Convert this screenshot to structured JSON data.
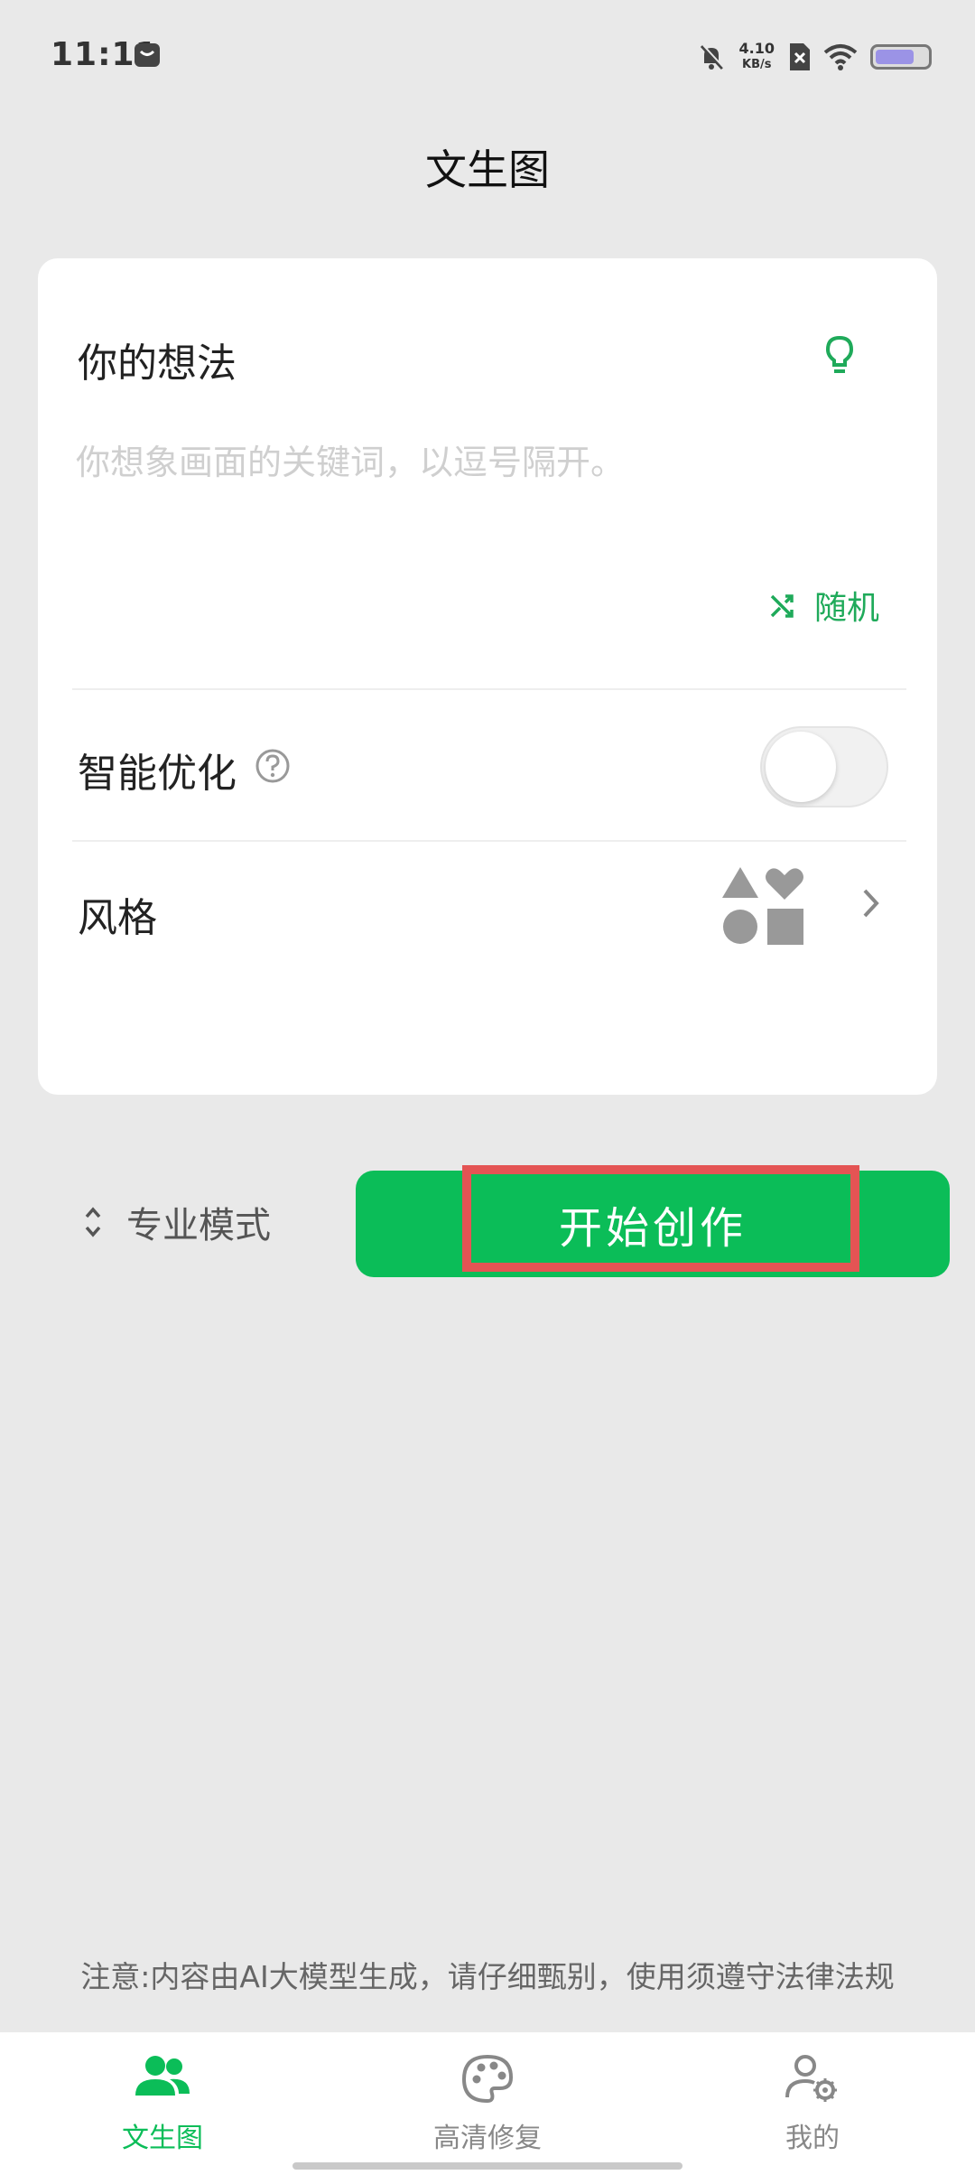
{
  "status_bar": {
    "time": "11:11",
    "net_speed_value": "4.10",
    "net_speed_unit": "KB/s",
    "battery_level": 0.75,
    "icons": [
      "message-icon",
      "mute-bell-icon",
      "no-sim-icon",
      "wifi-icon",
      "battery-icon"
    ]
  },
  "header": {
    "title": "文生图"
  },
  "card": {
    "idea_label": "你的想法",
    "idea_placeholder": "你想象画面的关键词，以逗号隔开。",
    "idea_value": "",
    "random_label": "随机",
    "optimize_label": "智能优化",
    "optimize_enabled": false,
    "style_label": "风格"
  },
  "actions": {
    "pro_mode_label": "专业模式",
    "start_label": "开始创作"
  },
  "disclaimer": "注意:内容由AI大模型生成，请仔细甄别，使用须遵守法律法规",
  "bottom_nav": {
    "items": [
      {
        "label": "文生图",
        "icon": "people-icon",
        "active": true
      },
      {
        "label": "高清修复",
        "icon": "palette-icon",
        "active": false
      },
      {
        "label": "我的",
        "icon": "user-settings-icon",
        "active": false
      }
    ]
  },
  "colors": {
    "accent": "#0bbd58",
    "highlight": "#e45454",
    "background": "#e9e9e9"
  }
}
